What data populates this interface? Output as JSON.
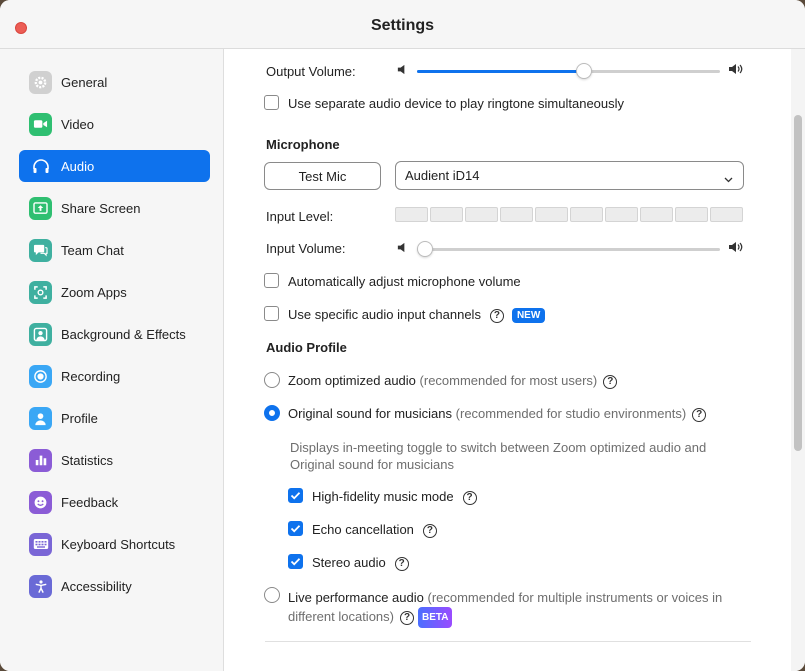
{
  "window": {
    "title": "Settings"
  },
  "sidebar": {
    "items": [
      {
        "label": "General",
        "icon": "gear-icon",
        "color": "#9b9b9b"
      },
      {
        "label": "Video",
        "icon": "video-icon",
        "color": "#2fbf71"
      },
      {
        "label": "Audio",
        "icon": "headphones-icon",
        "color": "#ffffff",
        "active": true
      },
      {
        "label": "Share Screen",
        "icon": "share-screen-icon",
        "color": "#2fbf71"
      },
      {
        "label": "Team Chat",
        "icon": "chat-icon",
        "color": "#3fb0a0"
      },
      {
        "label": "Zoom Apps",
        "icon": "apps-icon",
        "color": "#3fb0a0"
      },
      {
        "label": "Background & Effects",
        "icon": "background-icon",
        "color": "#3fb0a0"
      },
      {
        "label": "Recording",
        "icon": "recording-icon",
        "color": "#3aa7f5"
      },
      {
        "label": "Profile",
        "icon": "profile-icon",
        "color": "#3aa7f5"
      },
      {
        "label": "Statistics",
        "icon": "statistics-icon",
        "color": "#8b5cd6"
      },
      {
        "label": "Feedback",
        "icon": "feedback-icon",
        "color": "#8b5cd6"
      },
      {
        "label": "Keyboard Shortcuts",
        "icon": "keyboard-icon",
        "color": "#7a66d6"
      },
      {
        "label": "Accessibility",
        "icon": "accessibility-icon",
        "color": "#6a6ad6"
      }
    ]
  },
  "audio": {
    "output_volume_label": "Output Volume:",
    "output_volume_level": 0.55,
    "ringtone_label": "Use separate audio device to play ringtone simultaneously",
    "microphone_title": "Microphone",
    "test_mic_label": "Test Mic",
    "mic_device": "Audient iD14",
    "input_level_label": "Input Level:",
    "input_level_segments": 10,
    "input_volume_label": "Input Volume:",
    "input_volume_level": 0.0,
    "auto_adjust_label": "Automatically adjust microphone volume",
    "specific_channels_label": "Use specific audio input channels",
    "new_badge": "NEW",
    "profile_title": "Audio Profile",
    "zoom_optimized_label": "Zoom optimized audio",
    "zoom_optimized_note": "(recommended for most users)",
    "original_sound_label": "Original sound for musicians",
    "original_sound_note": "(recommended for studio environments)",
    "original_sound_desc_line1": "Displays in-meeting toggle to switch between Zoom optimized audio and",
    "original_sound_desc_line2": "Original sound for musicians",
    "hifi_label": "High-fidelity music mode",
    "echo_label": "Echo cancellation",
    "stereo_label": "Stereo audio",
    "live_perf_label": "Live performance audio",
    "live_perf_note_line1": "(recommended for multiple instruments or voices in",
    "live_perf_note_line2": "different locations)",
    "beta_badge": "BETA",
    "help_glyph": "?"
  },
  "colors": {
    "accent": "#0e72ed",
    "close": "#ec5d55"
  }
}
